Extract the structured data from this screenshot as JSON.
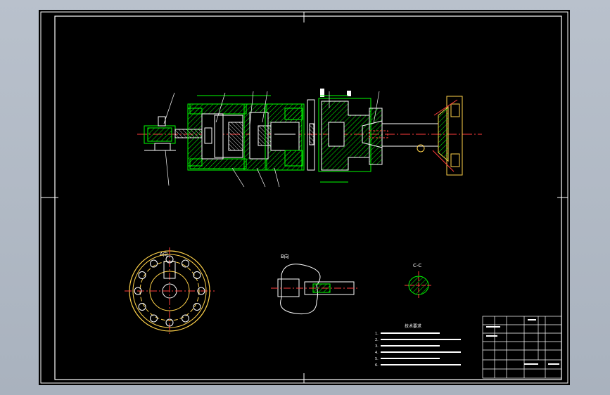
{
  "drawing": {
    "view_labels": [
      "A向",
      "B向",
      "C-C"
    ],
    "notes_title": "技术要求",
    "notes_lines": [
      "1.",
      "2.",
      "3.",
      "4.",
      "5.",
      "6."
    ],
    "title_block": {
      "part_name": "",
      "drawing_no": ""
    }
  },
  "colors": {
    "background": "#000000",
    "frame": "#ffffff",
    "hatch": "#00ff00",
    "part": "#ffffff",
    "centerline": "#ff3b3b",
    "flange": "#ffd24a",
    "dims": "#00ff00"
  }
}
